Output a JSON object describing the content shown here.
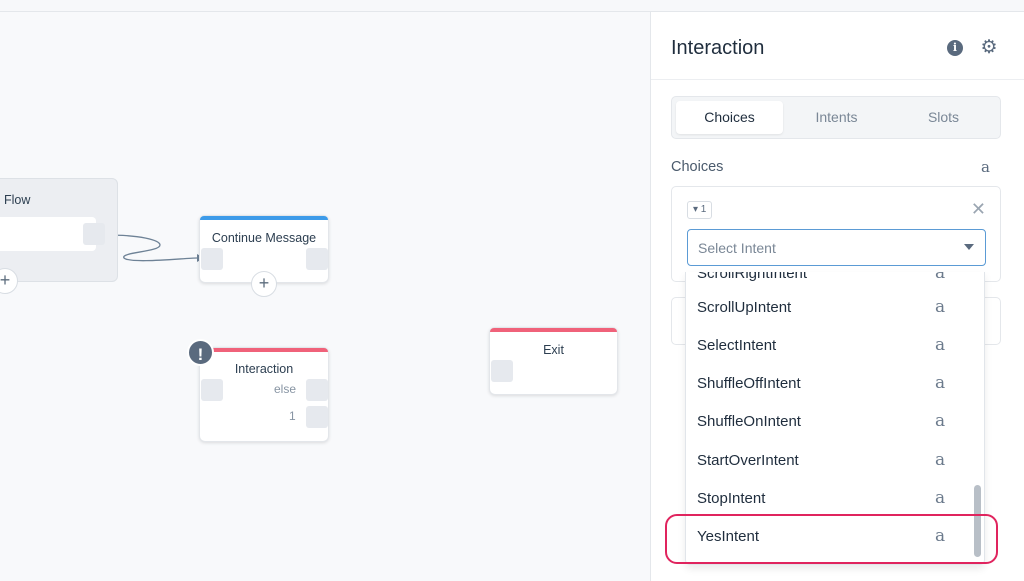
{
  "canvas": {
    "flow_block": {
      "title": "Flow"
    },
    "continue_message": {
      "title": "Continue Message",
      "color": "#3d9be9"
    },
    "interaction": {
      "title": "Interaction",
      "outputs": [
        "else",
        "1"
      ],
      "color": "#f0627a",
      "warning": "!"
    },
    "exit": {
      "title": "Exit",
      "color": "#f0627a"
    },
    "plus_label": "+"
  },
  "panel": {
    "title": "Interaction",
    "info_icon": "i",
    "gear_icon": "⚙",
    "tabs": [
      {
        "label": "Choices",
        "active": true
      },
      {
        "label": "Intents",
        "active": false
      },
      {
        "label": "Slots",
        "active": false
      }
    ],
    "section_label": "Choices",
    "amazon_icon": "a",
    "choice": {
      "chip": "▾ 1",
      "close": "✕",
      "select_placeholder": "Select Intent"
    }
  },
  "dropdown": {
    "items": [
      {
        "label": "ScrollRightIntent"
      },
      {
        "label": "ScrollUpIntent"
      },
      {
        "label": "SelectIntent"
      },
      {
        "label": "ShuffleOffIntent"
      },
      {
        "label": "ShuffleOnIntent"
      },
      {
        "label": "StartOverIntent"
      },
      {
        "label": "StopIntent"
      },
      {
        "label": "YesIntent",
        "highlighted": true
      }
    ],
    "item_icon": "a"
  }
}
